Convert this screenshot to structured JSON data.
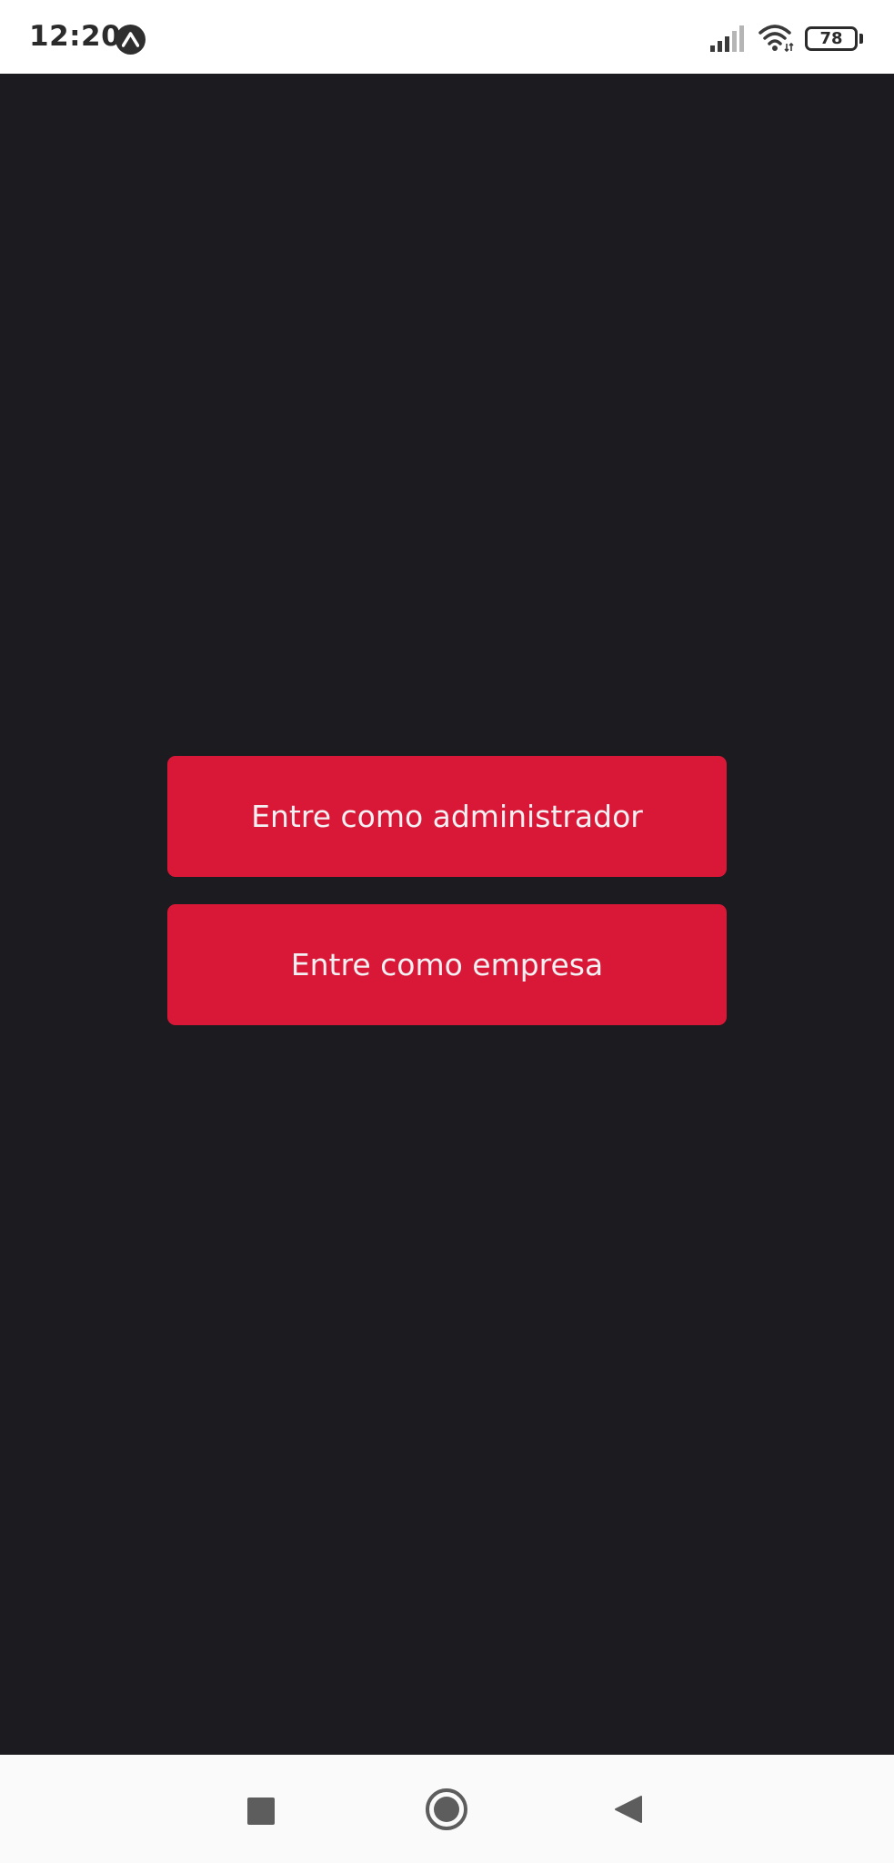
{
  "status_bar": {
    "time": "12:20",
    "battery_level": "78",
    "icons": [
      "expo-icon",
      "signal-icon",
      "wifi-icon",
      "battery-icon"
    ]
  },
  "main": {
    "background": "#1c1b20",
    "buttons": [
      {
        "label": "Entre como administrador",
        "color": "#d91838"
      },
      {
        "label": "Entre como empresa",
        "color": "#d91838"
      }
    ]
  },
  "nav_bar": {
    "icons": [
      "recents-icon",
      "home-icon",
      "back-icon"
    ]
  }
}
